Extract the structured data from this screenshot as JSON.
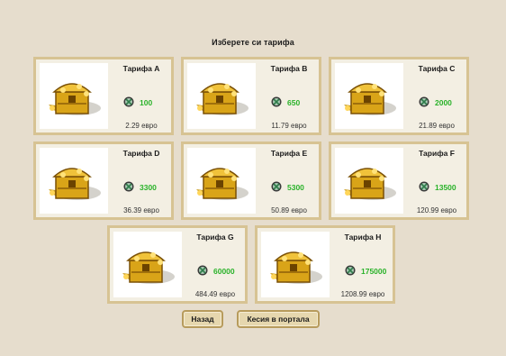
{
  "page": {
    "title": "Изберете си тарифа"
  },
  "tariffs": [
    {
      "name": "Тарифа A",
      "amount": "100",
      "price": "2.29 евро"
    },
    {
      "name": "Тарифа B",
      "amount": "650",
      "price": "11.79 евро"
    },
    {
      "name": "Тарифа C",
      "amount": "2000",
      "price": "21.89 евро"
    },
    {
      "name": "Тарифа D",
      "amount": "3300",
      "price": "36.39 евро"
    },
    {
      "name": "Тарифа E",
      "amount": "5300",
      "price": "50.89 евро"
    },
    {
      "name": "Тарифа F",
      "amount": "13500",
      "price": "120.99 евро"
    },
    {
      "name": "Тарифа G",
      "amount": "60000",
      "price": "484.49 евро"
    },
    {
      "name": "Тарифа H",
      "amount": "175000",
      "price": "1208.99 евро"
    }
  ],
  "buttons": {
    "back": "Назад",
    "wallet": "Кесия в портала"
  },
  "colors": {
    "background": "#e6ddcd",
    "card_border": "#d7c393",
    "amount": "#29b229"
  },
  "icons": {
    "chest": "treasure-chest-icon",
    "coin": "gem-coin-icon"
  }
}
